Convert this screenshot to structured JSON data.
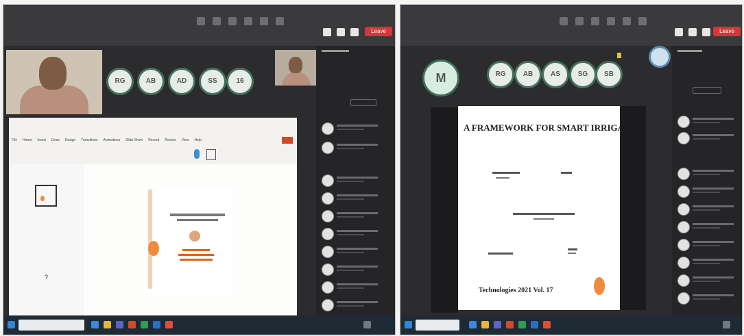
{
  "left_window": {
    "participants": [
      {
        "initials": "RG"
      },
      {
        "initials": "AB"
      },
      {
        "initials": "AD"
      },
      {
        "initials": "SS"
      },
      {
        "initials": "16"
      }
    ],
    "ribbon_menu": [
      "File",
      "Home",
      "Insert",
      "Draw",
      "Design",
      "Transitions",
      "Animations",
      "Slide Show",
      "Record",
      "Review",
      "View",
      "Help"
    ],
    "leave_label": "Leave",
    "desktop_icon_glyph": "?",
    "icons": [
      "camera-icon",
      "mic-icon",
      "share-icon",
      "chat-icon",
      "people-icon",
      "search-icon",
      "windows-icon"
    ]
  },
  "right_window": {
    "presenter_initial": "M",
    "participants": [
      {
        "initials": "RG"
      },
      {
        "initials": "AB"
      },
      {
        "initials": "AS"
      },
      {
        "initials": "SG"
      },
      {
        "initials": "SB"
      }
    ],
    "slide": {
      "title": "A FRAMEWORK FOR SMART IRRIGATION",
      "footer": "Technologies 2021  Vol. 17"
    },
    "leave_label": "Leave",
    "icons": [
      "camera-icon",
      "mic-icon",
      "share-icon",
      "chat-icon",
      "people-icon",
      "search-icon",
      "windows-icon"
    ]
  },
  "colors": {
    "leave": "#d8343a",
    "avatar_ring": "#46725e",
    "accent": "#f08a3c",
    "taskbar": "#1e2a34"
  }
}
